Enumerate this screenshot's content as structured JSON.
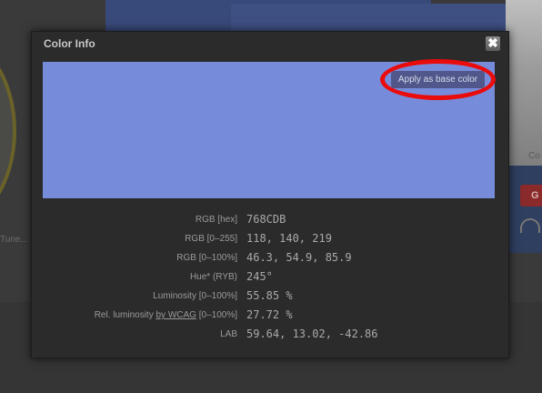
{
  "modal": {
    "title": "Color Info",
    "close_glyph": "✖",
    "close_icon": "close-icon",
    "swatch_color": "#768CDB",
    "apply_label": "Apply as base color",
    "highlight_color": "#ea0b0b"
  },
  "info_rows": [
    {
      "label": "RGB [hex]",
      "value": "768CDB"
    },
    {
      "label": "RGB [0–255]",
      "value": "118, 140, 219"
    },
    {
      "label": "RGB [0–100%]",
      "value": "46.3, 54.9, 85.9"
    },
    {
      "label": "Hue* (RYB)",
      "value": "245°"
    },
    {
      "label": "Luminosity [0–100%]",
      "value": "55.85 %"
    },
    {
      "label_prefix": "Rel. luminosity ",
      "label_link": "by WCAG",
      "label_suffix": " [0–100%]",
      "value": "27.72 %"
    },
    {
      "label": "LAB",
      "value": "59.64, 13.02, -42.86"
    }
  ],
  "background": {
    "left_text": "Tune...",
    "right_photo_label": "Co",
    "right_button_label": "G"
  }
}
